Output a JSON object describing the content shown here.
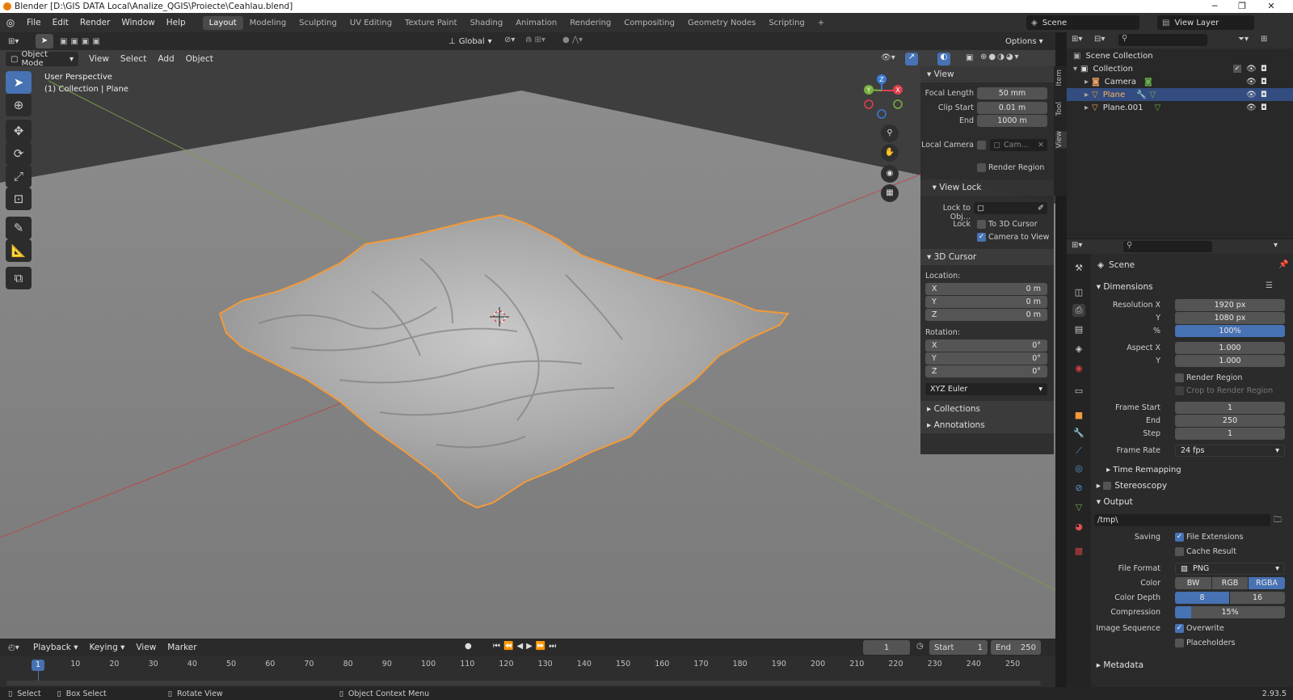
{
  "window": {
    "title": "Blender [D:\\GIS DATA Local\\Analize_QGIS\\Proiecte\\Ceahlau.blend]"
  },
  "menu": [
    "File",
    "Edit",
    "Render",
    "Window",
    "Help"
  ],
  "workspaces": [
    "Layout",
    "Modeling",
    "Sculpting",
    "UV Editing",
    "Texture Paint",
    "Shading",
    "Animation",
    "Rendering",
    "Compositing",
    "Geometry Nodes",
    "Scripting"
  ],
  "active_workspace": "Layout",
  "scene_name": "Scene",
  "view_layer": "View Layer",
  "viewport": {
    "transform_orientation": "Global",
    "options_label": "Options",
    "mode": "Object Mode",
    "header_menus": [
      "View",
      "Select",
      "Add",
      "Object"
    ],
    "overlay_line1": "User Perspective",
    "overlay_line2": "(1) Collection | Plane",
    "gizmo_axes": {
      "x": "X",
      "y": "Y",
      "z": "Z"
    }
  },
  "npanel": {
    "tabs": [
      "Item",
      "Tool",
      "View"
    ],
    "view_section": "View",
    "focal_length_label": "Focal Length",
    "focal_length": "50 mm",
    "clip_start_label": "Clip Start",
    "clip_start": "0.01 m",
    "clip_end_label": "End",
    "clip_end": "1000 m",
    "local_camera_label": "Local Camera",
    "local_camera_value": "Cam...",
    "render_region_label": "Render Region",
    "view_lock_section": "View Lock",
    "lock_to_obj_label": "Lock to Obj...",
    "lock_label": "Lock",
    "to_3d_cursor_label": "To 3D Cursor",
    "camera_to_view_label": "Camera to View",
    "cursor_section": "3D Cursor",
    "location_label": "Location:",
    "loc": [
      {
        "axis": "X",
        "value": "0 m"
      },
      {
        "axis": "Y",
        "value": "0 m"
      },
      {
        "axis": "Z",
        "value": "0 m"
      }
    ],
    "rotation_label": "Rotation:",
    "rot": [
      {
        "axis": "X",
        "value": "0°"
      },
      {
        "axis": "Y",
        "value": "0°"
      },
      {
        "axis": "Z",
        "value": "0°"
      }
    ],
    "rotation_mode": "XYZ Euler",
    "collections_section": "Collections",
    "annotations_section": "Annotations"
  },
  "outliner": {
    "root": "Scene Collection",
    "collection": "Collection",
    "items": [
      "Camera",
      "Plane",
      "Plane.001"
    ]
  },
  "properties": {
    "context": "Scene",
    "dimensions_section": "Dimensions",
    "resolution_x_label": "Resolution X",
    "resolution_x": "1920 px",
    "resolution_y_label": "Y",
    "resolution_y": "1080 px",
    "resolution_pct_label": "%",
    "resolution_pct": "100%",
    "aspect_x_label": "Aspect X",
    "aspect_x": "1.000",
    "aspect_y_label": "Y",
    "aspect_y": "1.000",
    "render_region_label": "Render Region",
    "crop_label": "Crop to Render Region",
    "frame_start_label": "Frame Start",
    "frame_start": "1",
    "frame_end_label": "End",
    "frame_end": "250",
    "frame_step_label": "Step",
    "frame_step": "1",
    "frame_rate_label": "Frame Rate",
    "frame_rate": "24 fps",
    "time_remapping_section": "Time Remapping",
    "stereoscopy_section": "Stereoscopy",
    "output_section": "Output",
    "output_path": "/tmp\\",
    "saving_label": "Saving",
    "file_extensions_label": "File Extensions",
    "cache_result_label": "Cache Result",
    "file_format_label": "File Format",
    "file_format": "PNG",
    "color_label": "Color",
    "color_options": [
      "BW",
      "RGB",
      "RGBA"
    ],
    "color_selected": "RGBA",
    "color_depth_label": "Color Depth",
    "color_depth_options": [
      "8",
      "16"
    ],
    "color_depth_selected": "8",
    "compression_label": "Compression",
    "compression": "15%",
    "compression_fraction": 0.15,
    "image_sequence_label": "Image Sequence",
    "overwrite_label": "Overwrite",
    "placeholders_label": "Placeholders",
    "metadata_section": "Metadata"
  },
  "timeline": {
    "menus": [
      "Playback",
      "Keying",
      "View",
      "Marker"
    ],
    "current_frame": "1",
    "start_label": "Start",
    "start": "1",
    "end_label": "End",
    "end": "250",
    "ticks": [
      "10",
      "20",
      "30",
      "40",
      "50",
      "60",
      "70",
      "80",
      "90",
      "100",
      "110",
      "120",
      "130",
      "140",
      "150",
      "160",
      "170",
      "180",
      "190",
      "200",
      "210",
      "220",
      "230",
      "240",
      "250"
    ],
    "playhead": "1"
  },
  "status": {
    "select": "Select",
    "box_select": "Box Select",
    "rotate_view": "Rotate View",
    "context_menu": "Object Context Menu",
    "version": "2.93.5"
  },
  "colors": {
    "accent": "#4772b3",
    "selection": "#f39a3a",
    "x_axis": "#e04050",
    "y_axis": "#7ab040",
    "z_axis": "#3b7bd6"
  }
}
